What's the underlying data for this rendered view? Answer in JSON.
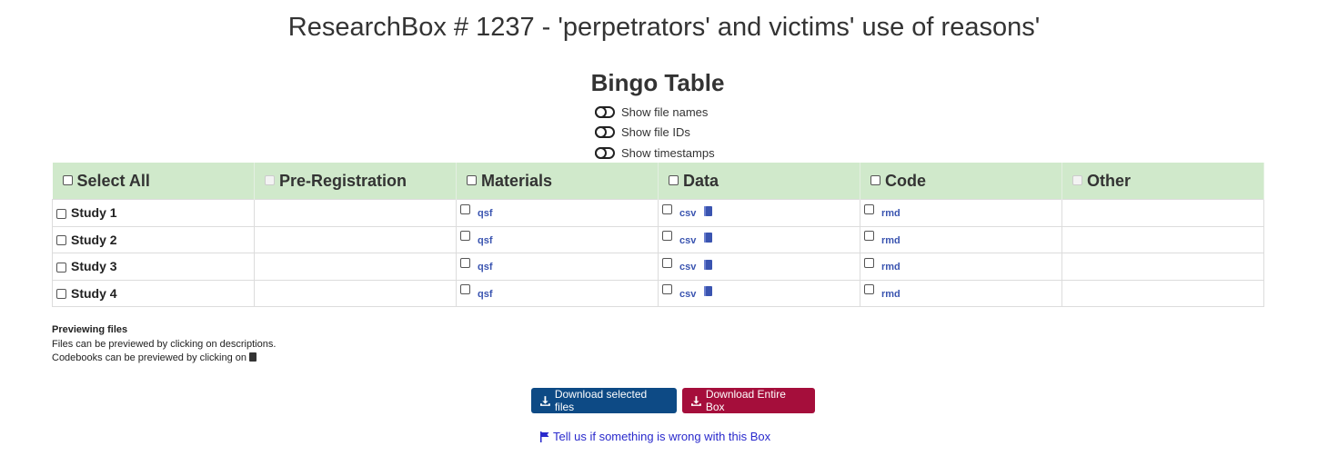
{
  "page": {
    "title": "ResearchBox # 1237 - 'perpetrators' and victims' use of reasons'"
  },
  "bingo": {
    "title": "Bingo Table",
    "toggles": [
      {
        "label": "Show file names"
      },
      {
        "label": "Show file IDs"
      },
      {
        "label": "Show timestamps"
      }
    ],
    "headers": {
      "select_all": "Select All",
      "preregistration": "Pre-Registration",
      "materials": "Materials",
      "data": "Data",
      "code": "Code",
      "other": "Other"
    },
    "rows": [
      {
        "study": "Study 1",
        "materials": "qsf",
        "data": "csv",
        "code": "rmd"
      },
      {
        "study": "Study 2",
        "materials": "qsf",
        "data": "csv",
        "code": "rmd"
      },
      {
        "study": "Study 3",
        "materials": "qsf",
        "data": "csv",
        "code": "rmd"
      },
      {
        "study": "Study 4",
        "materials": "qsf",
        "data": "csv",
        "code": "rmd"
      }
    ]
  },
  "notes": {
    "title": "Previewing files",
    "line1": "Files can be previewed by clicking on descriptions.",
    "line2": "Codebooks can be previewed by clicking on"
  },
  "actions": {
    "download_selected": "Download selected files",
    "download_entire": "Download Entire Box",
    "report": "Tell us if something is wrong with this Box"
  },
  "colors": {
    "header_bg": "#d0e9cb",
    "link": "#3a54b0",
    "btn_primary": "#0d4a85",
    "btn_danger": "#a50e3b"
  },
  "icons": {
    "codebook": "book-icon",
    "download": "download-icon",
    "report": "flag-icon"
  }
}
